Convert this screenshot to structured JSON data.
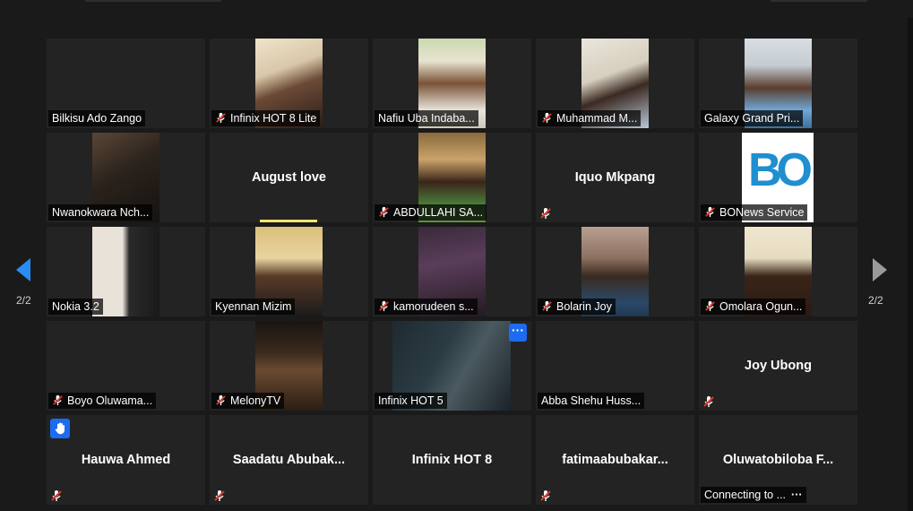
{
  "pagination": {
    "left_label": "2/2",
    "right_label": "2/2"
  },
  "colors": {
    "accent": "#1d6bf0",
    "mute": "#e0362b",
    "speaking": "#f5e56b",
    "tile_bg": "#232323"
  },
  "participants": [
    {
      "name": "Bilkisu Ado Zango",
      "muted": false
    },
    {
      "name": "Infinix HOT 8 Lite",
      "muted": true
    },
    {
      "name": "Nafiu Uba Indaba...",
      "muted": false
    },
    {
      "name": "Muhammad M...",
      "muted": true
    },
    {
      "name": "Galaxy Grand Pri...",
      "muted": false
    },
    {
      "name": "Nwanokwara Nch...",
      "muted": false
    },
    {
      "name": "August love",
      "muted": false
    },
    {
      "name": "ABDULLAHI SA...",
      "muted": true
    },
    {
      "name": "Iquo Mkpang",
      "muted": true
    },
    {
      "name": "BONews Service",
      "muted": true,
      "logo_text": "BO"
    },
    {
      "name": "Nokia 3.2",
      "muted": false
    },
    {
      "name": "Kyennan Mizim",
      "muted": false
    },
    {
      "name": "kamorudeen s...",
      "muted": true
    },
    {
      "name": "Bolarin Joy",
      "muted": true
    },
    {
      "name": "Omolara Ogun...",
      "muted": true
    },
    {
      "name": "Boyo Oluwama...",
      "muted": true
    },
    {
      "name": "MelonyTV",
      "muted": true
    },
    {
      "name": "Infinix HOT 5",
      "muted": false,
      "more": "···"
    },
    {
      "name": "Abba Shehu Huss...",
      "muted": false
    },
    {
      "name": "Joy Ubong",
      "muted": true
    },
    {
      "name": "Hauwa Ahmed",
      "muted": true
    },
    {
      "name": "Saadatu  Abubak...",
      "muted": true
    },
    {
      "name": "Infinix HOT 8",
      "muted": false
    },
    {
      "name": "fatimaabubakar...",
      "muted": true
    },
    {
      "name": "Oluwatobiloba  F...",
      "muted": false,
      "status": "Connecting to ...",
      "more": "···"
    }
  ]
}
